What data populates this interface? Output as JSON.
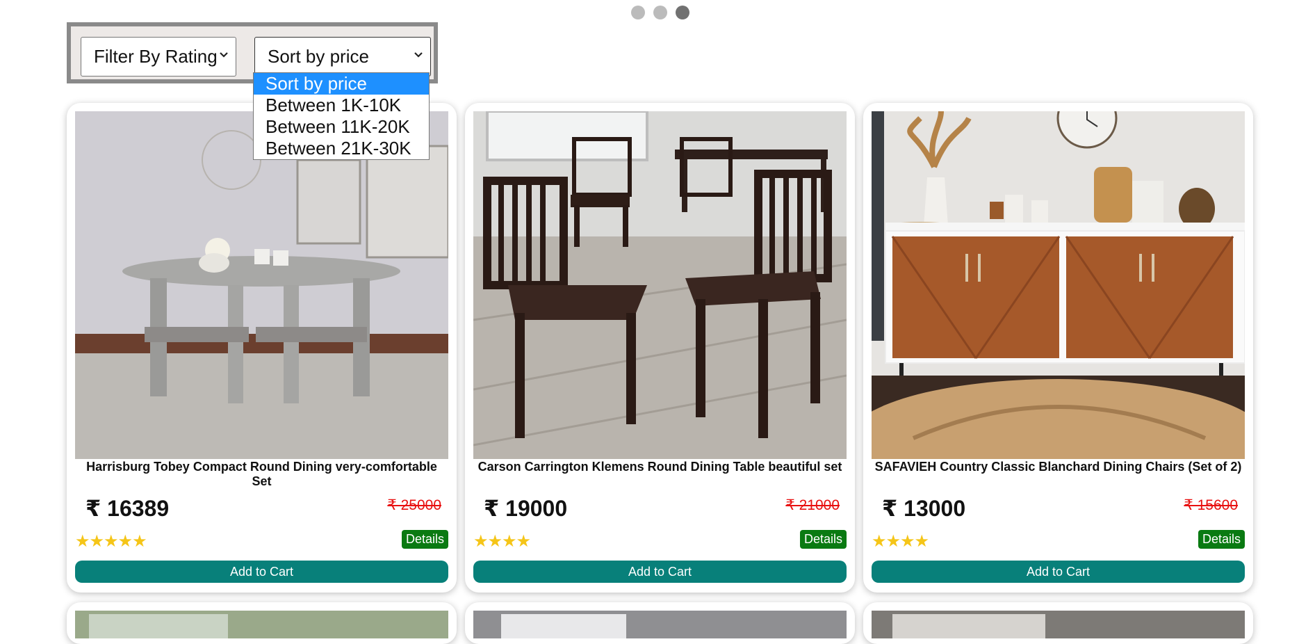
{
  "carousel": {
    "dot_count": 3,
    "active_index": 2
  },
  "filters": {
    "rating_select": {
      "value": "Filter By Rating"
    },
    "price_select": {
      "value": "Sort by price",
      "options": [
        "Sort by price",
        "Between 1K-10K",
        "Between 11K-20K",
        "Between 21K-30K"
      ],
      "highlighted": "Sort by price"
    }
  },
  "currency": "₹",
  "products": [
    {
      "name": "Harrisburg Tobey Compact Round Dining very-comfortable Set",
      "price": "₹ 16389",
      "mrp": "₹ 25000",
      "stars": "★★★★★",
      "rating": 5,
      "details_label": "Details",
      "cart_label": "Add to Cart",
      "image": "round-dining-set"
    },
    {
      "name": "Carson Carrington Klemens Round Dining Table beautiful set",
      "price": "₹ 19000",
      "mrp": "₹ 21000",
      "stars": "★★★★",
      "rating": 4,
      "details_label": "Details",
      "cart_label": "Add to Cart",
      "image": "wooden-dining-chairs"
    },
    {
      "name": "SAFAVIEH Country Classic Blanchard Dining Chairs (Set of 2)",
      "price": "₹ 13000",
      "mrp": "₹ 15600",
      "stars": "★★★★",
      "rating": 4,
      "details_label": "Details",
      "cart_label": "Add to Cart",
      "image": "sideboard-cabinet"
    }
  ],
  "colors": {
    "accent_teal": "#08807a",
    "details_green": "#0a7a12",
    "strike_red": "#e81010",
    "star_gold": "#f5c518",
    "dropdown_highlight": "#1e90ff"
  }
}
